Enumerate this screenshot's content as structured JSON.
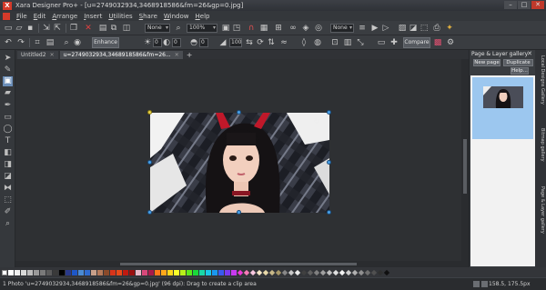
{
  "window": {
    "title": "Xara Designer Pro+ - [u=2749032934,3468918586&fm=26&gp=0.jpg]",
    "minimize": "–",
    "maximize": "□",
    "close": "✕"
  },
  "menu": [
    "File",
    "Edit",
    "Arrange",
    "Insert",
    "Utilities",
    "Share",
    "Window",
    "Help"
  ],
  "toolbar": {
    "line_width": "None",
    "zoom": "100%",
    "transparency": "None",
    "enhance_label": "Enhance",
    "brightness_value": "0",
    "contrast_value": "0",
    "saturation_value": "0",
    "opacity_value": "100",
    "compare_label": "Compare"
  },
  "tabs": [
    {
      "label": "Untitled2",
      "close": "✕"
    },
    {
      "label": "u=2749032934,3468918586&fm=26...",
      "close": "✕"
    }
  ],
  "tab_add": "+",
  "gallery": {
    "title": "Page & Layer gallery",
    "new_page": "New page",
    "duplicate": "Duplicate",
    "help": "Help..."
  },
  "side_tabs": [
    "Local Designs Gallery",
    "Bitmap gallery",
    "Page & Layer gallery"
  ],
  "status": {
    "text": "1 Photo 'u=2749032934,3468918586&fm=26&gp=0.jpg' (96 dpi): Drag to create a clip area",
    "coords": "158.5, 175.5px"
  },
  "palette": [
    "#ffffff",
    "#f0f0f0",
    "#d8d8d8",
    "#bcbcbc",
    "#9a9a9a",
    "#7a7a7a",
    "#5a5a5a",
    "#3a3a3a",
    "#000000",
    "#2a3a8a",
    "#1d57c8",
    "#4a8ad4",
    "#2f6bd0",
    "#c8a08a",
    "#b57a5a",
    "#8a4a2a",
    "#d8341a",
    "#e84a1a",
    "#c01a10",
    "#9a1010",
    "#e8b8c8",
    "#d8487a",
    "#a81a4a",
    "#ff7a1a",
    "#ffa81a",
    "#ffd81a",
    "#f8ff2a",
    "#b8f01a",
    "#5ae81a",
    "#1ad83a",
    "#1ad8a8",
    "#1ac8e8",
    "#1a98f0",
    "#3a5af0",
    "#7a3af0",
    "#c83af0",
    "#f03ad8",
    "#f87ab8",
    "#f8c8e0",
    "#f8e8c8",
    "#e8d8a8",
    "#c8b888",
    "#a89868",
    "#888888",
    "#c8c8c8",
    "#eaeaea",
    "#404040",
    "#606060",
    "#808080",
    "#a0a0a0",
    "#c0c0c0",
    "#e0e0e0",
    "#f4f4f4",
    "#d0d0d0",
    "#b0b0b0",
    "#909090",
    "#707070",
    "#505050",
    "#303030",
    "#101010"
  ]
}
